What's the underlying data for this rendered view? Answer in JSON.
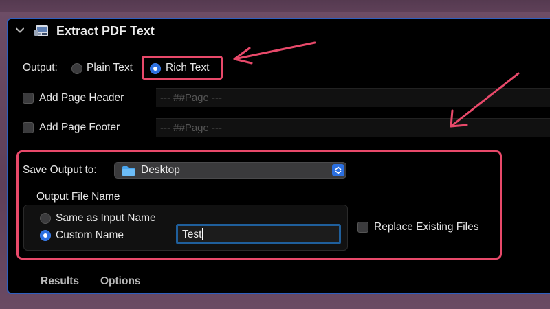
{
  "action": {
    "title": "Extract PDF Text",
    "output_label": "Output:",
    "plain_text_label": "Plain Text",
    "rich_text_label": "Rich Text",
    "selected_output": "Rich Text",
    "add_page_header_label": "Add Page Header",
    "add_page_header_value": "--- ##Page ---",
    "add_page_header_checked": false,
    "add_page_footer_label": "Add Page Footer",
    "add_page_footer_value": "--- ##Page ---",
    "add_page_footer_checked": false,
    "save_output_label": "Save Output to:",
    "save_location": "Desktop",
    "output_file_name_label": "Output File Name",
    "same_as_input_label": "Same as Input Name",
    "custom_name_label": "Custom Name",
    "selected_name_option": "Custom Name",
    "custom_name_value": "Test",
    "replace_existing_label": "Replace Existing Files",
    "replace_existing_checked": false
  },
  "tabs": {
    "results": "Results",
    "options": "Options"
  },
  "colors": {
    "annotation_red": "#e8496a",
    "accent_blue": "#2b6fe0",
    "panel_border": "#2f5fbe"
  },
  "icons": {
    "disclosure": "chevron-down-icon",
    "action": "automator-action-icon",
    "folder": "folder-icon",
    "popup": "chevron-up-down-icon"
  }
}
